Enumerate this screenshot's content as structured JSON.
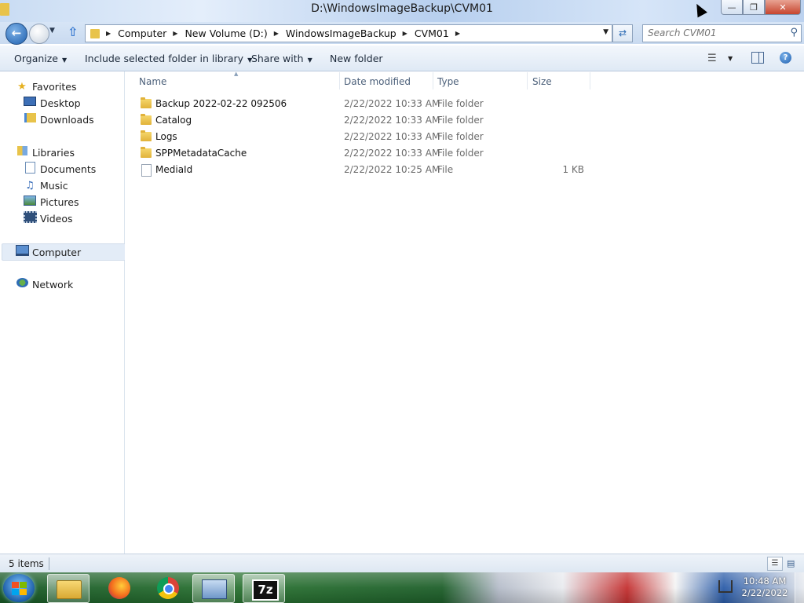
{
  "window": {
    "title": "D:\\WindowsImageBackup\\CVM01",
    "minimize_glyph": "—",
    "restore_glyph": "❐",
    "close_glyph": "✕"
  },
  "address": {
    "breadcrumbs": [
      {
        "label": "Computer"
      },
      {
        "label": "New Volume (D:)"
      },
      {
        "label": "WindowsImageBackup"
      },
      {
        "label": "CVM01"
      }
    ],
    "search_placeholder": "Search CVM01"
  },
  "toolbar": {
    "organize": "Organize",
    "include_library": "Include selected folder in library",
    "share_with": "Share with",
    "new_folder": "New folder"
  },
  "nav": {
    "favorites": {
      "label": "Favorites",
      "items": [
        "Desktop",
        "Downloads"
      ]
    },
    "libraries": {
      "label": "Libraries",
      "items": [
        "Documents",
        "Music",
        "Pictures",
        "Videos"
      ]
    },
    "computer": "Computer",
    "network": "Network"
  },
  "columns": {
    "name": "Name",
    "date": "Date modified",
    "type": "Type",
    "size": "Size"
  },
  "files": [
    {
      "name": "Backup 2022-02-22 092506",
      "date": "2/22/2022 10:33 AM",
      "type": "File folder",
      "size": "",
      "kind": "folder"
    },
    {
      "name": "Catalog",
      "date": "2/22/2022 10:33 AM",
      "type": "File folder",
      "size": "",
      "kind": "folder"
    },
    {
      "name": "Logs",
      "date": "2/22/2022 10:33 AM",
      "type": "File folder",
      "size": "",
      "kind": "folder"
    },
    {
      "name": "SPPMetadataCache",
      "date": "2/22/2022 10:33 AM",
      "type": "File folder",
      "size": "",
      "kind": "folder"
    },
    {
      "name": "MediaId",
      "date": "2/22/2022 10:25 AM",
      "type": "File",
      "size": "1 KB",
      "kind": "file"
    }
  ],
  "status": {
    "items_count": "5 items"
  },
  "taskbar": {
    "app_7z_label": "7z",
    "clock_time": "10:48 AM",
    "clock_date": "2/22/2022"
  }
}
